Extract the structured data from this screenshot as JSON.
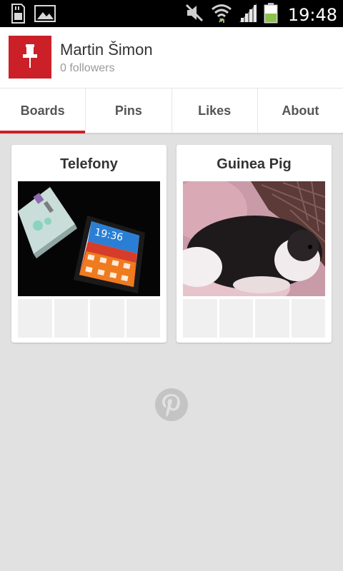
{
  "status_bar": {
    "time": "19:48",
    "left_icons": [
      "sd-card-icon",
      "gallery-icon"
    ],
    "right_icons": [
      "mute-icon",
      "wifi-icon",
      "signal-icon",
      "battery-icon"
    ]
  },
  "profile": {
    "name": "Martin Šimon",
    "followers": "0 followers",
    "avatar_color": "#cb2027"
  },
  "tabs": [
    {
      "label": "Boards",
      "active": true
    },
    {
      "label": "Pins",
      "active": false
    },
    {
      "label": "Likes",
      "active": false
    },
    {
      "label": "About",
      "active": false
    }
  ],
  "boards": [
    {
      "title": "Telefony",
      "cover": "phones-photo"
    },
    {
      "title": "Guinea Pig",
      "cover": "guinea-pig-photo"
    }
  ],
  "colors": {
    "brand_red": "#cb2027",
    "background": "#e1e1e1"
  }
}
